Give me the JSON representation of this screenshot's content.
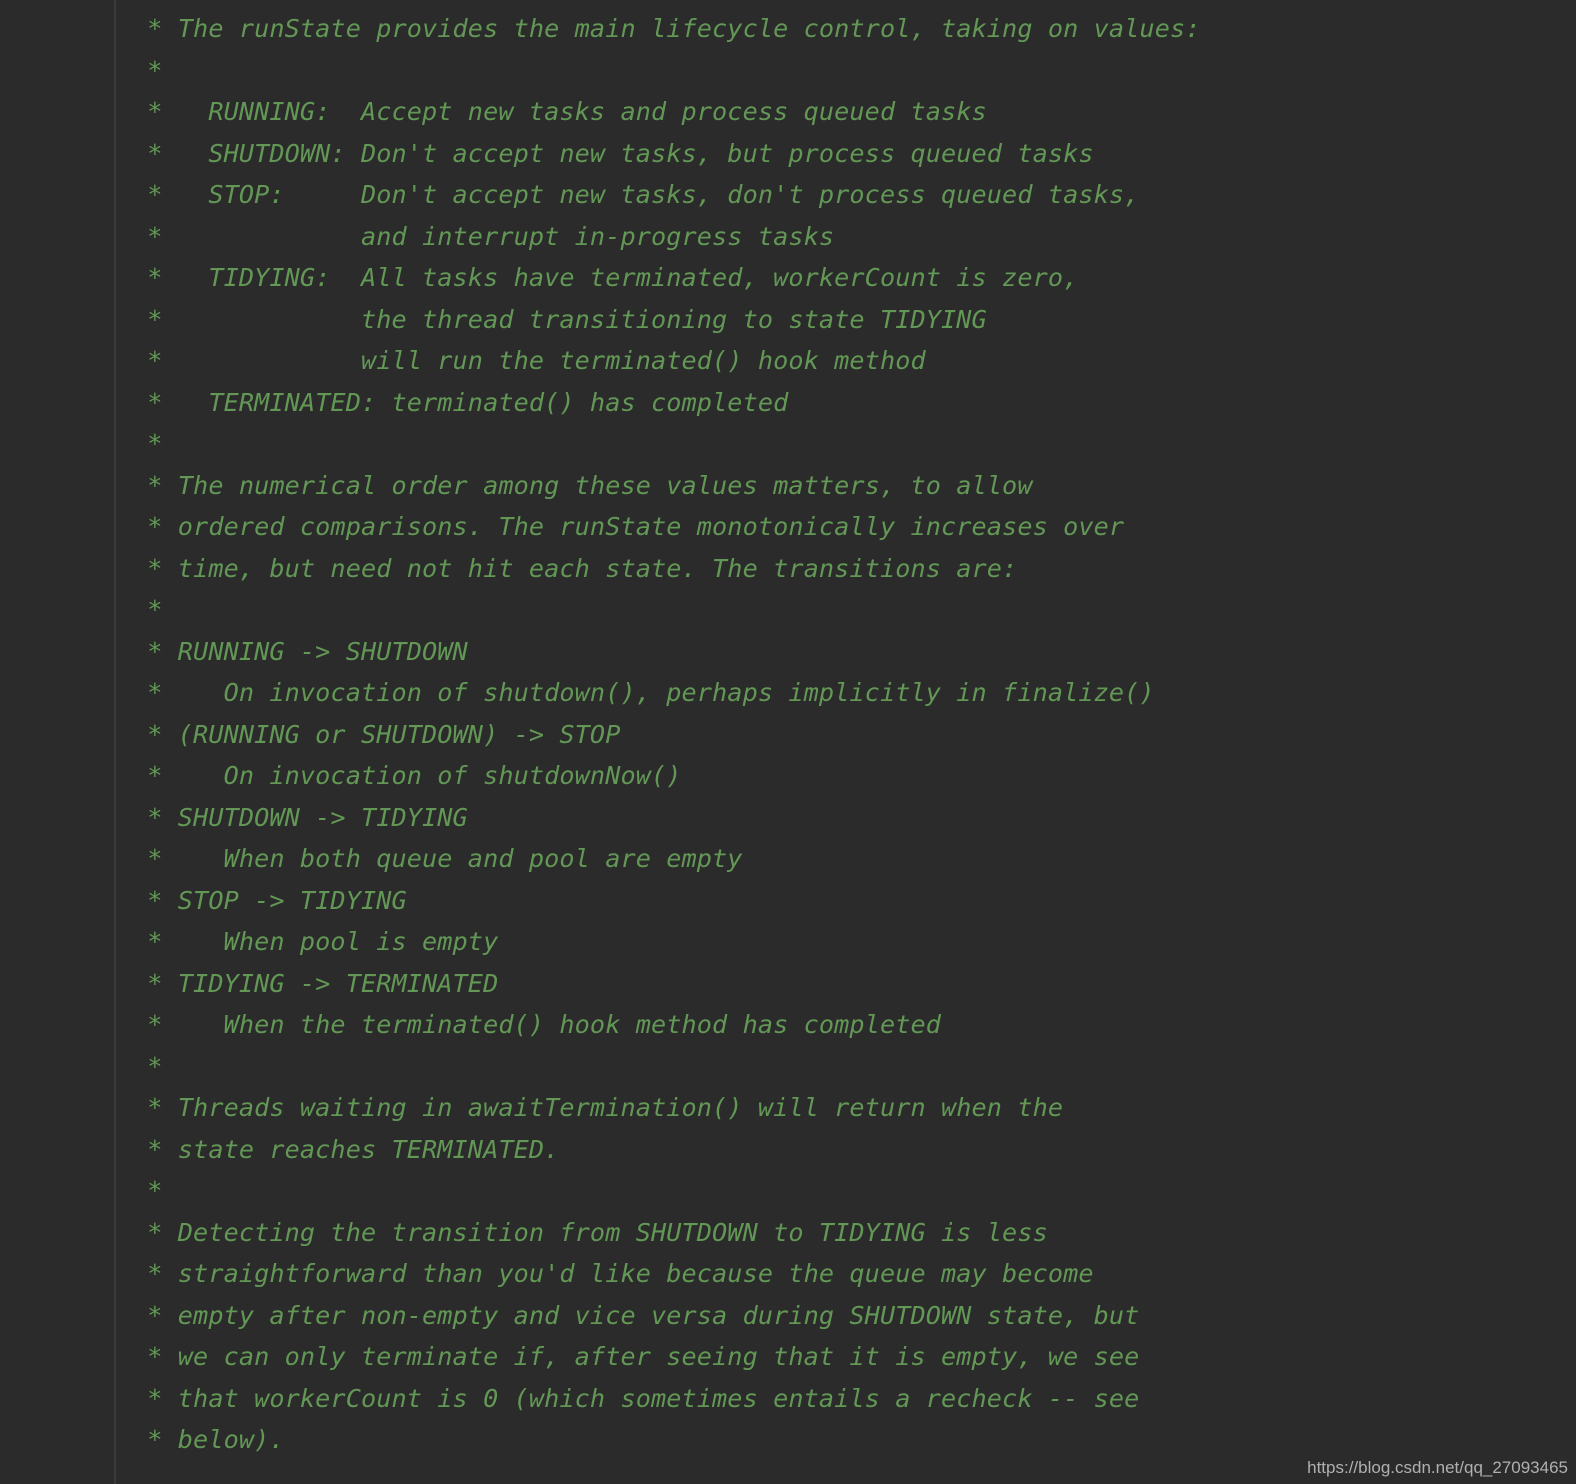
{
  "lines": [
    " * The runState provides the main lifecycle control, taking on values:",
    " *",
    " *   RUNNING:  Accept new tasks and process queued tasks",
    " *   SHUTDOWN: Don't accept new tasks, but process queued tasks",
    " *   STOP:     Don't accept new tasks, don't process queued tasks,",
    " *             and interrupt in-progress tasks",
    " *   TIDYING:  All tasks have terminated, workerCount is zero,",
    " *             the thread transitioning to state TIDYING",
    " *             will run the terminated() hook method",
    " *   TERMINATED: terminated() has completed",
    " *",
    " * The numerical order among these values matters, to allow",
    " * ordered comparisons. The runState monotonically increases over",
    " * time, but need not hit each state. The transitions are:",
    " *",
    " * RUNNING -> SHUTDOWN",
    " *    On invocation of shutdown(), perhaps implicitly in finalize()",
    " * (RUNNING or SHUTDOWN) -> STOP",
    " *    On invocation of shutdownNow()",
    " * SHUTDOWN -> TIDYING",
    " *    When both queue and pool are empty",
    " * STOP -> TIDYING",
    " *    When pool is empty",
    " * TIDYING -> TERMINATED",
    " *    When the terminated() hook method has completed",
    " *",
    " * Threads waiting in awaitTermination() will return when the",
    " * state reaches TERMINATED.",
    " *",
    " * Detecting the transition from SHUTDOWN to TIDYING is less",
    " * straightforward than you'd like because the queue may become",
    " * empty after non-empty and vice versa during SHUTDOWN state, but",
    " * we can only terminate if, after seeing that it is empty, we see",
    " * that workerCount is 0 (which sometimes entails a recheck -- see",
    " * below)."
  ],
  "watermark": "https://blog.csdn.net/qq_27093465"
}
